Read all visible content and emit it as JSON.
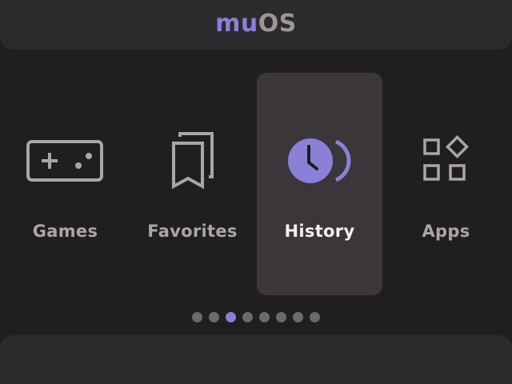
{
  "header": {
    "logo_part1": "mu",
    "logo_part2": "OS"
  },
  "menu": {
    "items": [
      {
        "label": "Games",
        "icon": "gamepad-icon"
      },
      {
        "label": "Favorites",
        "icon": "bookmarks-icon"
      },
      {
        "label": "History",
        "icon": "clock-history-icon"
      },
      {
        "label": "Apps",
        "icon": "apps-icon"
      }
    ],
    "selected_index": 2
  },
  "pagination": {
    "total": 8,
    "active_index": 2
  },
  "colors": {
    "accent": "#8b80d8",
    "background": "#201e20",
    "panel": "#2d2a2d",
    "selected_tile": "#3a363a",
    "icon": "#aaa5aa",
    "dot": "#6d696d"
  }
}
